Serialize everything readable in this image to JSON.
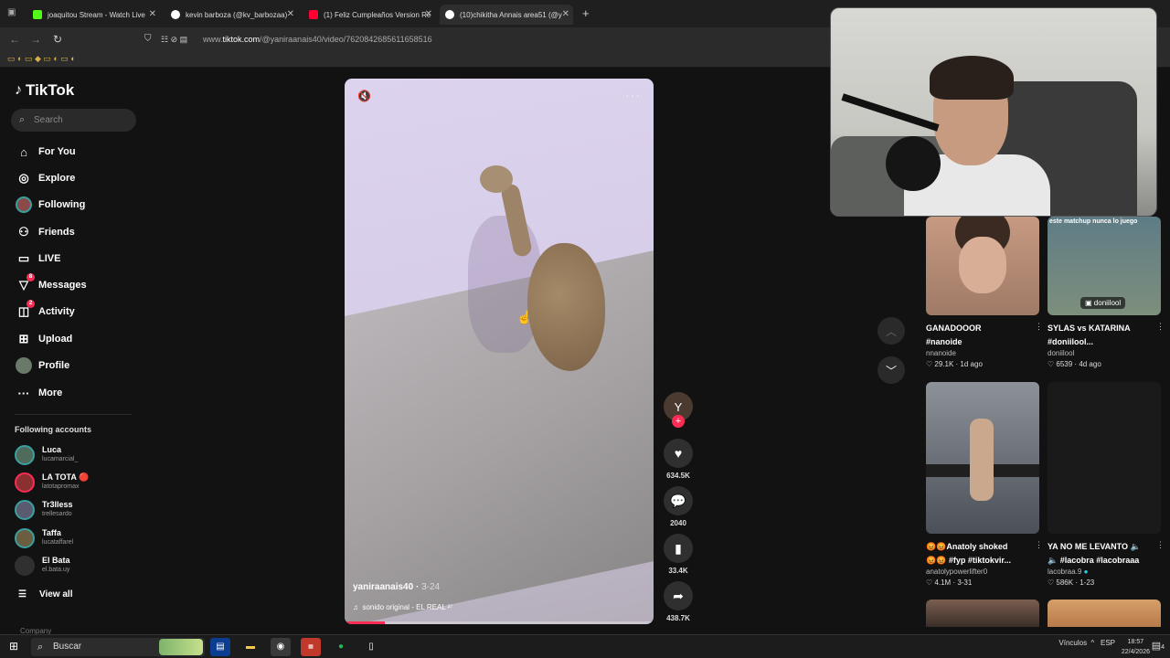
{
  "browser": {
    "tabs": [
      {
        "label": "joaquitou Stream - Watch Live",
        "favicon_color": "#53fc18"
      },
      {
        "label": "kevin barboza (@kv_barbozaa)",
        "favicon_color": "#ffffff"
      },
      {
        "label": "(1) Feliz Cumpleaños Version Re",
        "favicon_color": "#ff0033"
      },
      {
        "label": "(10)chikitha Annais area51 (@y",
        "favicon_color": "#ffffff"
      }
    ],
    "url_prefix": "www.",
    "url_domain": "tiktok.com",
    "url_path": "/@yaniraanais40/video/7620842685611658516"
  },
  "sidebar": {
    "logo": "TikTok",
    "search_placeholder": "Search",
    "nav": [
      {
        "label": "For You",
        "icon": "home-icon"
      },
      {
        "label": "Explore",
        "icon": "compass-icon"
      },
      {
        "label": "Following",
        "icon": "following-avatar-icon"
      },
      {
        "label": "Friends",
        "icon": "friends-icon"
      },
      {
        "label": "LIVE",
        "icon": "live-icon"
      },
      {
        "label": "Messages",
        "icon": "messages-icon",
        "badge": "8"
      },
      {
        "label": "Activity",
        "icon": "activity-icon",
        "badge": "2"
      },
      {
        "label": "Upload",
        "icon": "upload-icon"
      },
      {
        "label": "Profile",
        "icon": "profile-avatar-icon"
      },
      {
        "label": "More",
        "icon": "more-icon"
      }
    ],
    "following_title": "Following accounts",
    "accounts": [
      {
        "name": "Luca",
        "handle": "lucamarcial_",
        "color": "#4f6b5a"
      },
      {
        "name": "LA TOTA 🔴",
        "handle": "latotapromax",
        "color": "#8a3030"
      },
      {
        "name": "Tr3lless",
        "handle": "trellesardo",
        "color": "#5a5a70"
      },
      {
        "name": "Taffa",
        "handle": "lucataffarel",
        "color": "#6b5d40"
      },
      {
        "name": "El Bata",
        "handle": "el.bata.uy",
        "color": "#303030"
      }
    ],
    "view_all": "View all",
    "company": "Company"
  },
  "video": {
    "author": "yaniraanais40",
    "date": "3-24",
    "sound": "sonido original - EL REAL ²⁷",
    "progress": 0.13,
    "avatar_letter": "Y"
  },
  "actions": [
    {
      "icon": "heart-icon",
      "count": "634.5K"
    },
    {
      "icon": "comment-icon",
      "count": "2040"
    },
    {
      "icon": "bookmark-icon",
      "count": "33.4K"
    },
    {
      "icon": "share-icon",
      "count": "438.7K"
    }
  ],
  "recommended": [
    {
      "title": "GANADOOOR",
      "title2": "#nanoide",
      "author": "nnanoide",
      "likes": "29.1K",
      "age": "1d ago",
      "thumb_color": "#b8907a",
      "overlay": ""
    },
    {
      "title": "SYLAS vs KATARINA",
      "title2": "#doniilool...",
      "author": "doniilool",
      "likes": "6539",
      "age": "4d ago",
      "thumb_color": "#6f8a9a",
      "overlay": "este matchup nunca lo juego",
      "tag": "doniilool"
    },
    {
      "title": "😡😡Anatoly shoked",
      "title2": "😡😡 #fyp #tiktokvir...",
      "author": "anatolypowerlifter0",
      "likes": "4.1M",
      "age": "3-31",
      "thumb_color": "#5e6570",
      "overlay": ""
    },
    {
      "title": "YA NO ME LEVANTO 🔈",
      "title2": "🔈 #lacobra #lacobraaa",
      "author": "lacobraa.9",
      "likes": "586K",
      "age": "1-23",
      "thumb_color": "#1a1a1a",
      "overlay": ""
    }
  ],
  "taskbar": {
    "search": "Buscar",
    "tray_label": "Vínculos",
    "lang": "ESP",
    "time": "18:57",
    "date": "22/4/2026",
    "notif_count": "4"
  }
}
